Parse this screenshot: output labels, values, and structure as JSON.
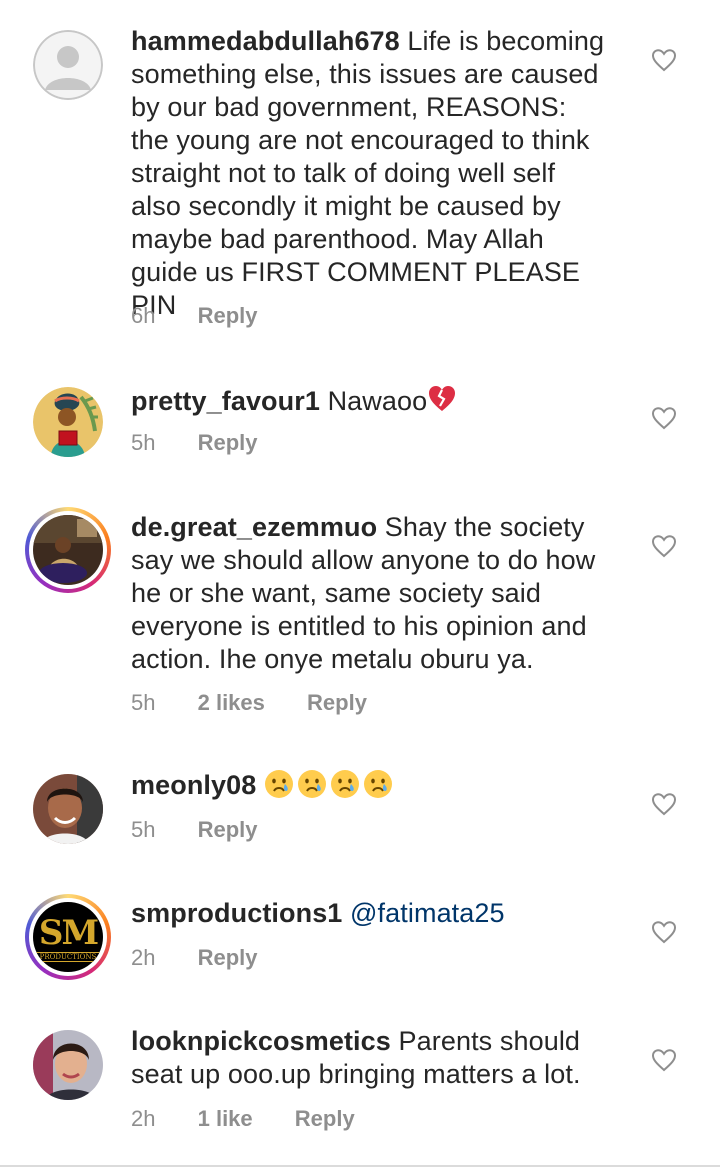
{
  "comments": [
    {
      "username": "hammedabdullah678",
      "text_lines": [
        "Life is becoming",
        "something else, this issues are caused",
        "by our bad government, REASONS:",
        "the young are not encouraged to think",
        "straight not to talk of doing well self",
        "also secondly it might be caused by",
        "maybe bad parenthood. May Allah",
        "guide us FIRST COMMENT PLEASE PIN"
      ],
      "time": "6h",
      "reply": "Reply"
    },
    {
      "username": "pretty_favour1",
      "text": "Nawaoo",
      "emoji": "broken-heart",
      "time": "5h",
      "reply": "Reply"
    },
    {
      "username": "de.great_ezemmuo",
      "text_lines": [
        "Shay the society",
        "say we should allow anyone to do how",
        "he or she want, same society said",
        "everyone is entitled to his opinion and",
        "action. Ihe onye metalu oburu ya."
      ],
      "time": "5h",
      "likes": "2 likes",
      "reply": "Reply"
    },
    {
      "username": "meonly08",
      "emoji": "crying-face",
      "emoji_count": 4,
      "time": "5h",
      "reply": "Reply"
    },
    {
      "username": "smproductions1",
      "mention": "@fatimata25",
      "avatar_text": "SM",
      "avatar_subtext": "PRODUCTIONS",
      "time": "2h",
      "reply": "Reply"
    },
    {
      "username": "looknpickcosmetics",
      "text_lines": [
        "Parents should",
        "seat up ooo.up bringing matters a lot."
      ],
      "time": "2h",
      "likes": "1 like",
      "reply": "Reply"
    }
  ]
}
